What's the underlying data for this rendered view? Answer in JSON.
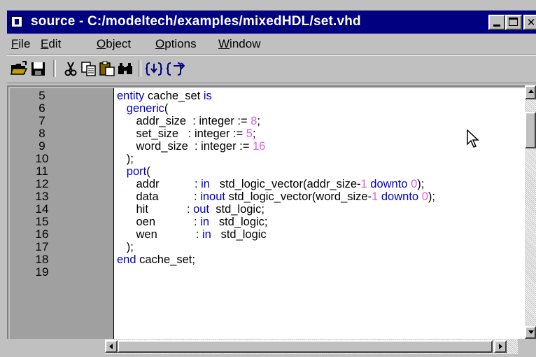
{
  "window": {
    "title": "source - C:/modeltech/examples/mixedHDL/set.vhd",
    "controls": {
      "minimize": "minimize-icon",
      "maximize": "maximize-icon",
      "close": "close-icon"
    },
    "title_bar_color": "#000080"
  },
  "menu": {
    "items": [
      {
        "label": "File",
        "access_key": "F"
      },
      {
        "label": "Edit",
        "access_key": "E"
      },
      {
        "label": "Object",
        "access_key": "O"
      },
      {
        "label": "Options",
        "access_key": "O"
      },
      {
        "label": "Window",
        "access_key": "W"
      }
    ]
  },
  "toolbar": {
    "icons": [
      "open-folder-icon",
      "save-icon",
      "cut-icon",
      "copy-icon",
      "paste-icon",
      "find-icon",
      "step-into-icon",
      "step-over-icon"
    ]
  },
  "editor": {
    "line_numbers": [
      "5",
      "6",
      "7",
      "8",
      "9",
      "10",
      "11",
      "12",
      "13",
      "14",
      "15",
      "16",
      "17",
      "18",
      "19"
    ],
    "keyword_color": "#0000cc",
    "number_color": "#e060e0",
    "lines": [
      [
        {
          "t": "entity",
          "k": "kw"
        },
        {
          "t": " cache_set ",
          "k": ""
        },
        {
          "t": "is",
          "k": "kw"
        }
      ],
      [
        {
          "t": "   ",
          "k": ""
        },
        {
          "t": "generic",
          "k": "kw"
        },
        {
          "t": "(",
          "k": ""
        }
      ],
      [
        {
          "t": "      addr_size  : integer := ",
          "k": ""
        },
        {
          "t": "8",
          "k": "num"
        },
        {
          "t": ";",
          "k": ""
        }
      ],
      [
        {
          "t": "      set_size   : integer := ",
          "k": ""
        },
        {
          "t": "5",
          "k": "num"
        },
        {
          "t": ";",
          "k": ""
        }
      ],
      [
        {
          "t": "      word_size  : integer := ",
          "k": ""
        },
        {
          "t": "16",
          "k": "num"
        }
      ],
      [
        {
          "t": "   );",
          "k": ""
        }
      ],
      [
        {
          "t": "   ",
          "k": ""
        },
        {
          "t": "port",
          "k": "kw"
        },
        {
          "t": "(",
          "k": ""
        }
      ],
      [
        {
          "t": "      addr           : ",
          "k": ""
        },
        {
          "t": "in",
          "k": "kw"
        },
        {
          "t": "   std_logic_vector(addr_size-",
          "k": ""
        },
        {
          "t": "1",
          "k": "num"
        },
        {
          "t": " ",
          "k": ""
        },
        {
          "t": "downto",
          "k": "kw"
        },
        {
          "t": " ",
          "k": ""
        },
        {
          "t": "0",
          "k": "num"
        },
        {
          "t": ");",
          "k": ""
        }
      ],
      [
        {
          "t": "      data           : ",
          "k": ""
        },
        {
          "t": "inout",
          "k": "kw"
        },
        {
          "t": " std_logic_vector(word_size-",
          "k": ""
        },
        {
          "t": "1",
          "k": "num"
        },
        {
          "t": " ",
          "k": ""
        },
        {
          "t": "downto",
          "k": "kw"
        },
        {
          "t": " ",
          "k": ""
        },
        {
          "t": "0",
          "k": "num"
        },
        {
          "t": ");",
          "k": ""
        }
      ],
      [
        {
          "t": "      hit            : ",
          "k": ""
        },
        {
          "t": "out",
          "k": "kw"
        },
        {
          "t": "  std_logic;",
          "k": ""
        }
      ],
      [
        {
          "t": "      oen            : ",
          "k": ""
        },
        {
          "t": "in",
          "k": "kw"
        },
        {
          "t": "   std_logic;",
          "k": ""
        }
      ],
      [
        {
          "t": "      wen            : ",
          "k": ""
        },
        {
          "t": "in",
          "k": "kw"
        },
        {
          "t": "   std_logic",
          "k": ""
        }
      ],
      [
        {
          "t": "   );",
          "k": ""
        }
      ],
      [
        {
          "t": "end",
          "k": "kw"
        },
        {
          "t": " cache_set;",
          "k": ""
        }
      ]
    ]
  }
}
